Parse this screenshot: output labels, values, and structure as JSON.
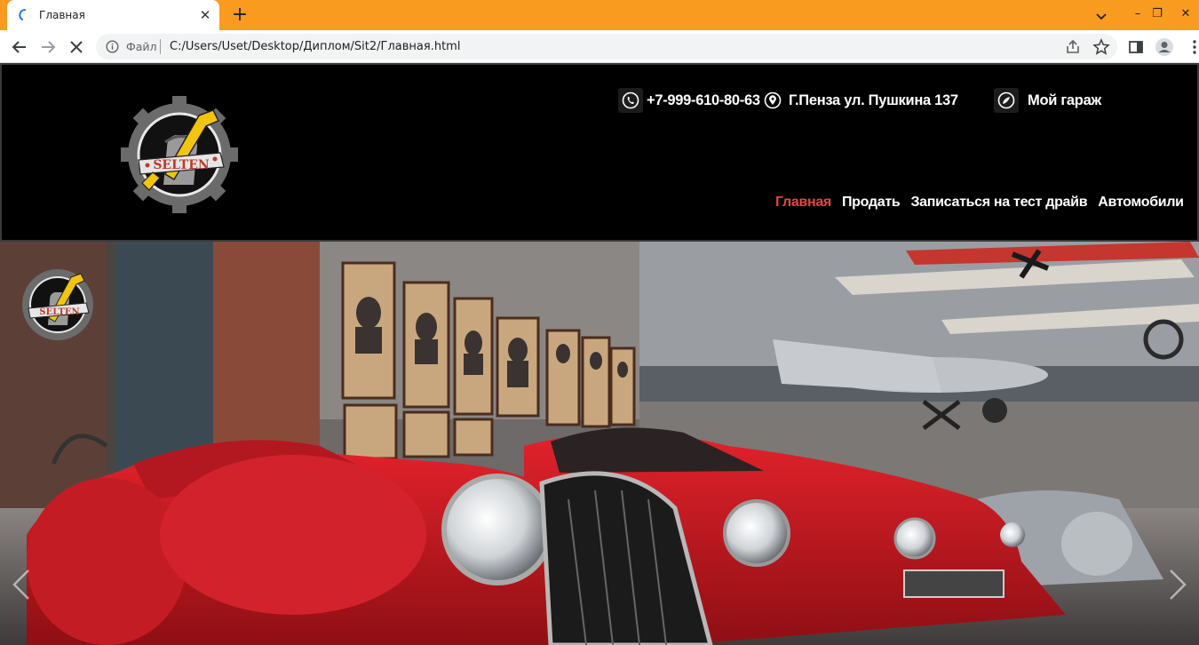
{
  "browser": {
    "tab_title": "Главная",
    "tab_close": "✕",
    "new_tab": "+",
    "scheme_label": "Файл",
    "url": "C:/Users/Uset/Desktop/Диплом/Sit2/Главная.html",
    "window_controls": [
      "–",
      "❐",
      "✕"
    ],
    "icons": [
      "back-icon",
      "forward-icon",
      "stop-loading-icon",
      "info-icon",
      "share-icon",
      "bookmark-star-icon",
      "side-panel-icon",
      "profile-icon",
      "menu-icon",
      "tab-search-icon"
    ],
    "accent_color": "#f99b1f"
  },
  "site": {
    "logo_text": "SELTEN",
    "phone": "+7-999-610-80-63",
    "address": "Г.Пенза ул. Пушкина 137",
    "garage": "Мой гараж",
    "nav": [
      {
        "label": "Главная",
        "active": true
      },
      {
        "label": "Продать",
        "active": false
      },
      {
        "label": "Записаться на тест драйв",
        "active": false
      },
      {
        "label": "Автомобили",
        "active": false
      }
    ],
    "active_nav_color": "#e2483d"
  },
  "hero": {
    "logo_text": "SELTEN",
    "icons": [
      "slider-prev-arrow-icon",
      "slider-next-arrow-icon"
    ]
  }
}
